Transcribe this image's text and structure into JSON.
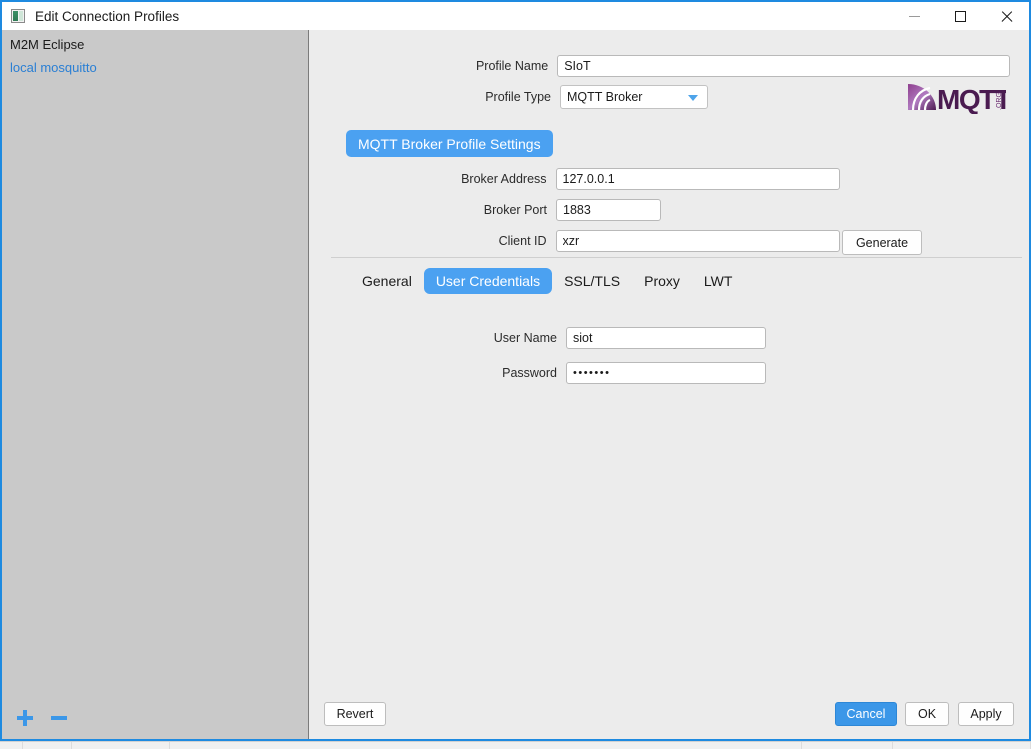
{
  "window": {
    "title": "Edit Connection Profiles",
    "icon": "app-window-icon",
    "minimize_label": "Minimize",
    "maximize_label": "Maximize",
    "close_label": "Close",
    "border_color": "#1e8ae0"
  },
  "sidebar": {
    "background": "#c9c9c9",
    "profiles": [
      {
        "label": "M2M Eclipse",
        "selected": false
      },
      {
        "label": "local mosquitto",
        "selected": true
      }
    ],
    "actions": [
      {
        "name": "add-profile",
        "icon": "plus-icon",
        "color": "#3b97e8"
      },
      {
        "name": "remove-profile",
        "icon": "minus-icon",
        "color": "#3b97e8"
      }
    ]
  },
  "main": {
    "profile_name": {
      "label": "Profile Name",
      "value": "SIoT",
      "placeholder": ""
    },
    "profile_type": {
      "label": "Profile Type",
      "value": "MQTT Broker",
      "options": [
        "MQTT Broker"
      ],
      "caret_color": "#4ea4ea"
    },
    "logo": {
      "name": "mqtt-org-logo",
      "text": "MQTT",
      "suffix": ".ORG"
    },
    "section_heading": {
      "label": "MQTT Broker Profile Settings",
      "color": "#4ba1f1"
    },
    "broker_address": {
      "label": "Broker Address",
      "value": "127.0.0.1",
      "placeholder": ""
    },
    "broker_port": {
      "label": "Broker Port",
      "value": "1883",
      "placeholder": ""
    },
    "client_id": {
      "label": "Client ID",
      "value": "xzr",
      "placeholder": ""
    },
    "generate_button": {
      "label": "Generate"
    },
    "tabs": [
      {
        "label": "General",
        "active": false
      },
      {
        "label": "User Credentials",
        "active": true
      },
      {
        "label": "SSL/TLS",
        "active": false
      },
      {
        "label": "Proxy",
        "active": false
      },
      {
        "label": "LWT",
        "active": false
      }
    ],
    "user_name": {
      "label": "User Name",
      "value": "siot",
      "placeholder": ""
    },
    "password": {
      "label": "Password",
      "value": "•••••••",
      "placeholder": ""
    }
  },
  "buttons": {
    "revert": "Revert",
    "cancel": "Cancel",
    "ok": "OK",
    "apply": "Apply",
    "primary_color": "#3b97e8"
  }
}
